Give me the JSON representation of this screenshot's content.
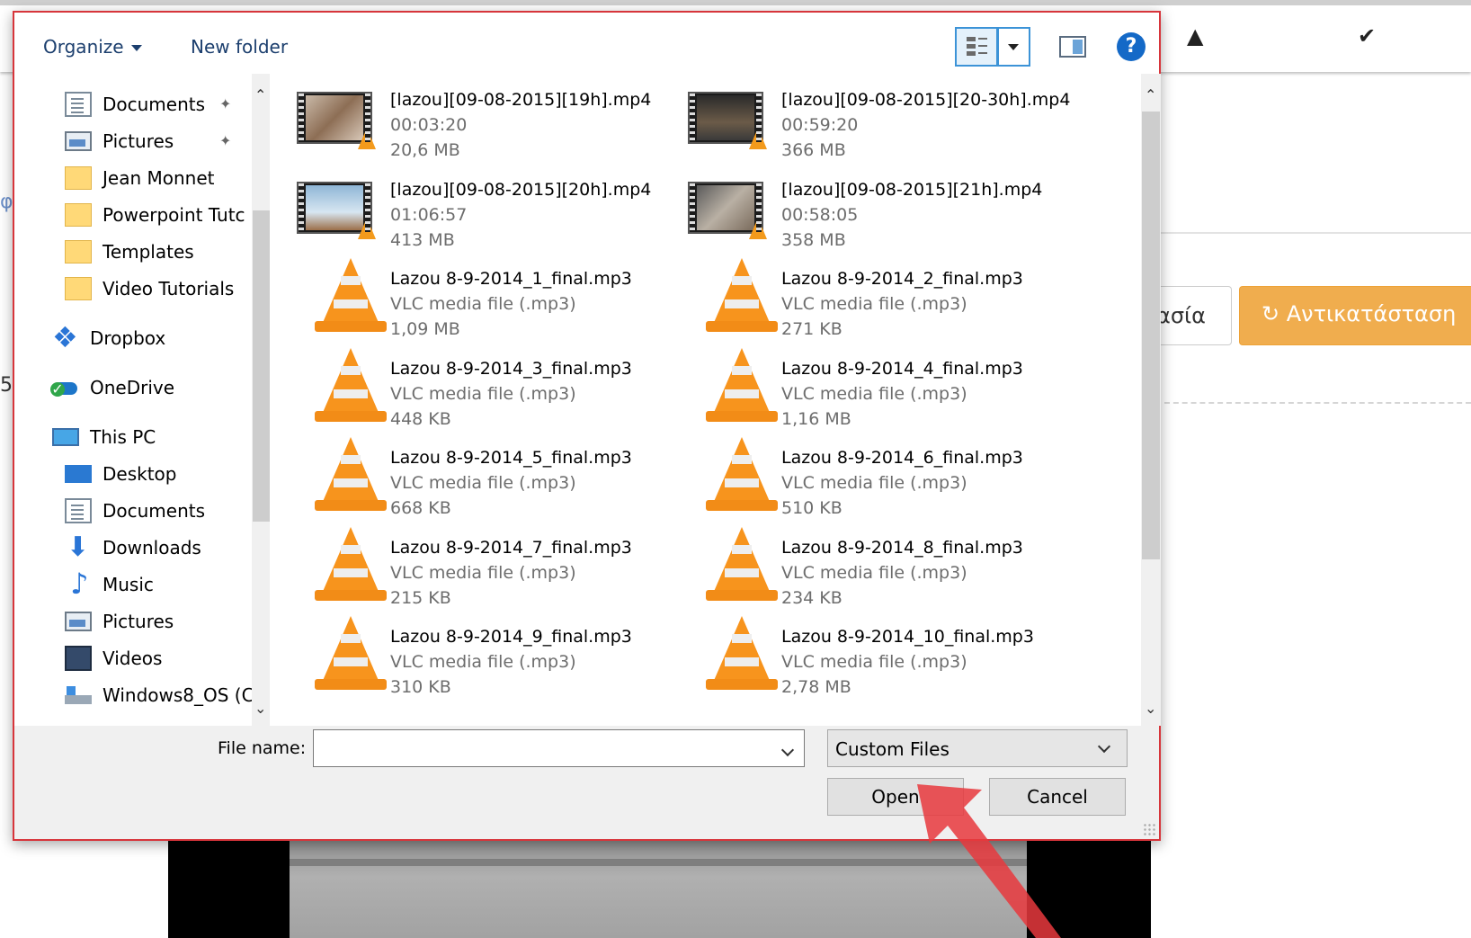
{
  "background": {
    "right_button_partial": "ασία",
    "replace_button": "Αντικατάσταση",
    "edge_text_1": "φ",
    "edge_text_2": "5"
  },
  "toolbar": {
    "organize": "Organize",
    "new_folder": "New folder",
    "help_glyph": "?"
  },
  "nav": {
    "items": [
      {
        "label": "Documents",
        "icon": "documents-icon",
        "pinned": true
      },
      {
        "label": "Pictures",
        "icon": "pictures-icon",
        "pinned": true
      },
      {
        "label": "Jean Monnet",
        "icon": "folder-icon"
      },
      {
        "label": "Powerpoint Tutc",
        "icon": "folder-icon"
      },
      {
        "label": "Templates",
        "icon": "folder-icon"
      },
      {
        "label": "Video Tutorials",
        "icon": "folder-icon"
      },
      {
        "label": "Dropbox",
        "icon": "dropbox-icon"
      },
      {
        "label": "OneDrive",
        "icon": "onedrive-icon"
      },
      {
        "label": "This PC",
        "icon": "this-pc-icon"
      },
      {
        "label": "Desktop",
        "icon": "desktop-icon"
      },
      {
        "label": "Documents",
        "icon": "documents-icon"
      },
      {
        "label": "Downloads",
        "icon": "downloads-icon"
      },
      {
        "label": "Music",
        "icon": "music-icon"
      },
      {
        "label": "Pictures",
        "icon": "pictures-icon"
      },
      {
        "label": "Videos",
        "icon": "videos-icon"
      },
      {
        "label": "Windows8_OS (C",
        "icon": "drive-icon"
      }
    ]
  },
  "files": [
    {
      "name": "[lazou][09-08-2015][19h].mp4",
      "line2": "00:03:20",
      "line3": "20,6 MB",
      "kind": "video"
    },
    {
      "name": "[lazou][09-08-2015][20-30h].mp4",
      "line2": "00:59:20",
      "line3": "366 MB",
      "kind": "video"
    },
    {
      "name": "[lazou][09-08-2015][20h].mp4",
      "line2": "01:06:57",
      "line3": "413 MB",
      "kind": "video"
    },
    {
      "name": "[lazou][09-08-2015][21h].mp4",
      "line2": "00:58:05",
      "line3": "358 MB",
      "kind": "video"
    },
    {
      "name": "Lazou 8-9-2014_1_final.mp3",
      "line2": "VLC media file (.mp3)",
      "line3": "1,09 MB",
      "kind": "audio"
    },
    {
      "name": "Lazou 8-9-2014_2_final.mp3",
      "line2": "VLC media file (.mp3)",
      "line3": "271 KB",
      "kind": "audio"
    },
    {
      "name": "Lazou 8-9-2014_3_final.mp3",
      "line2": "VLC media file (.mp3)",
      "line3": "448 KB",
      "kind": "audio"
    },
    {
      "name": "Lazou 8-9-2014_4_final.mp3",
      "line2": "VLC media file (.mp3)",
      "line3": "1,16 MB",
      "kind": "audio"
    },
    {
      "name": "Lazou 8-9-2014_5_final.mp3",
      "line2": "VLC media file (.mp3)",
      "line3": "668 KB",
      "kind": "audio"
    },
    {
      "name": "Lazou 8-9-2014_6_final.mp3",
      "line2": "VLC media file (.mp3)",
      "line3": "510 KB",
      "kind": "audio"
    },
    {
      "name": "Lazou 8-9-2014_7_final.mp3",
      "line2": "VLC media file (.mp3)",
      "line3": "215 KB",
      "kind": "audio"
    },
    {
      "name": "Lazou 8-9-2014_8_final.mp3",
      "line2": "VLC media file (.mp3)",
      "line3": "234 KB",
      "kind": "audio"
    },
    {
      "name": "Lazou 8-9-2014_9_final.mp3",
      "line2": "VLC media file (.mp3)",
      "line3": "310 KB",
      "kind": "audio"
    },
    {
      "name": "Lazou 8-9-2014_10_final.mp3",
      "line2": "VLC media file (.mp3)",
      "line3": "2,78 MB",
      "kind": "audio"
    }
  ],
  "bottom": {
    "file_name_label": "File name:",
    "file_name_value": "",
    "file_type": "Custom Files",
    "open_button": "Open",
    "cancel_button": "Cancel"
  },
  "colors": {
    "dialog_border": "#d7353b",
    "accent_blue": "#1469c7",
    "replace_button": "#f0ad4e",
    "annotation_arrow": "#e8383d"
  }
}
